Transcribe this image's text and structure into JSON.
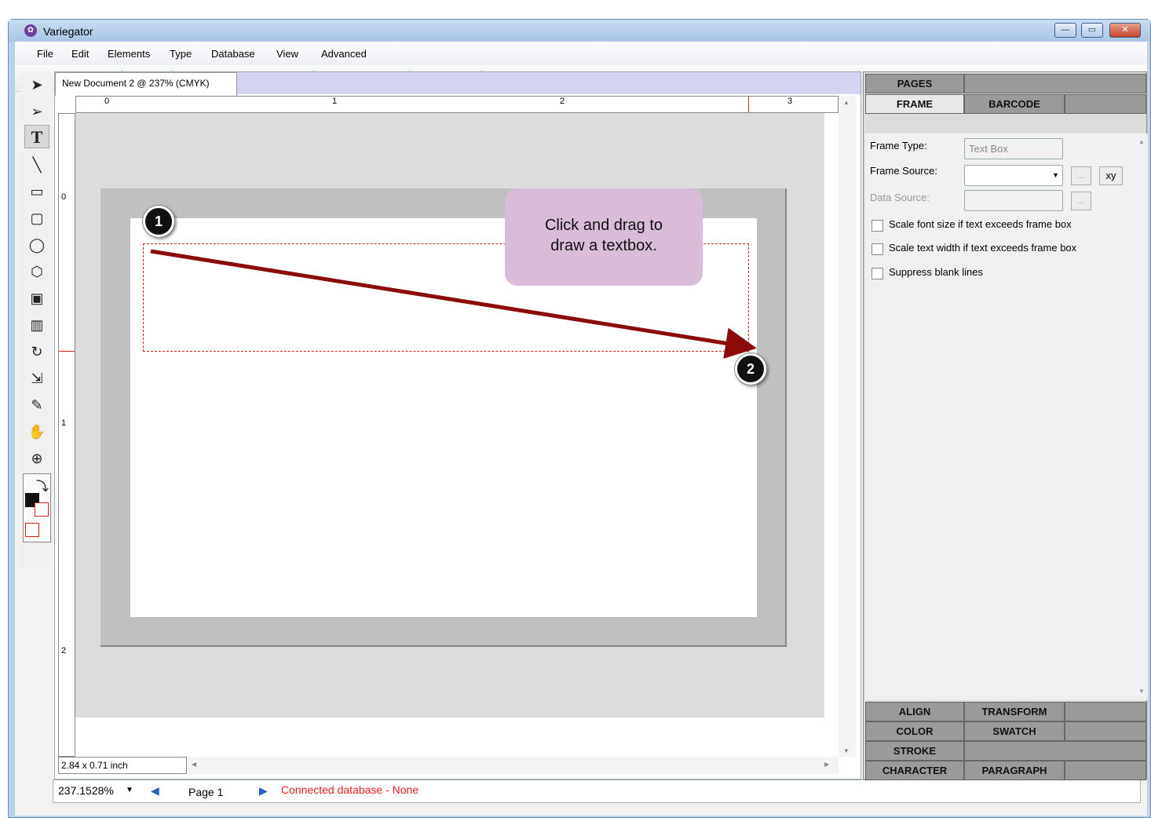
{
  "window": {
    "title": "Variegator",
    "app_icon": "variegator-logo"
  },
  "menu": [
    "File",
    "Edit",
    "Elements",
    "Type",
    "Database",
    "View",
    "Advanced"
  ],
  "document": {
    "tab_title": "New Document 2 @ 237% (CMYK)",
    "size_readout": "2.84 x 0.71 inch"
  },
  "rulers": {
    "h_labels": [
      "0",
      "1",
      "2",
      "3"
    ],
    "v_labels": [
      "0",
      "1",
      "2"
    ]
  },
  "callout": {
    "line1": "Click and drag to",
    "line2": "draw a textbox."
  },
  "steps": [
    "1",
    "2"
  ],
  "status": {
    "zoom": "237.1528%",
    "page": "Page 1",
    "database": "Connected database - None"
  },
  "panel": {
    "tabs_top": [
      "PAGES",
      "FRAME",
      "BARCODE"
    ],
    "frame_type_label": "Frame Type:",
    "frame_type_value": "Text Box",
    "frame_source_label": "Frame Source:",
    "data_source_label": "Data Source:",
    "xy_button": "xy",
    "browse_button": "...",
    "check_scale_font": "Scale font size if text exceeds frame box",
    "check_scale_width": "Scale text width if text exceeds frame box",
    "check_suppress": "Suppress blank lines",
    "tabs_bottom": [
      "ALIGN",
      "TRANSFORM",
      "COLOR",
      "SWATCH",
      "STROKE",
      "CHARACTER",
      "PARAGRAPH"
    ]
  },
  "colors": {
    "accent_red": "#e02020",
    "callout_bg": "#d8bcd8",
    "arrow": "#8b0a0a"
  }
}
